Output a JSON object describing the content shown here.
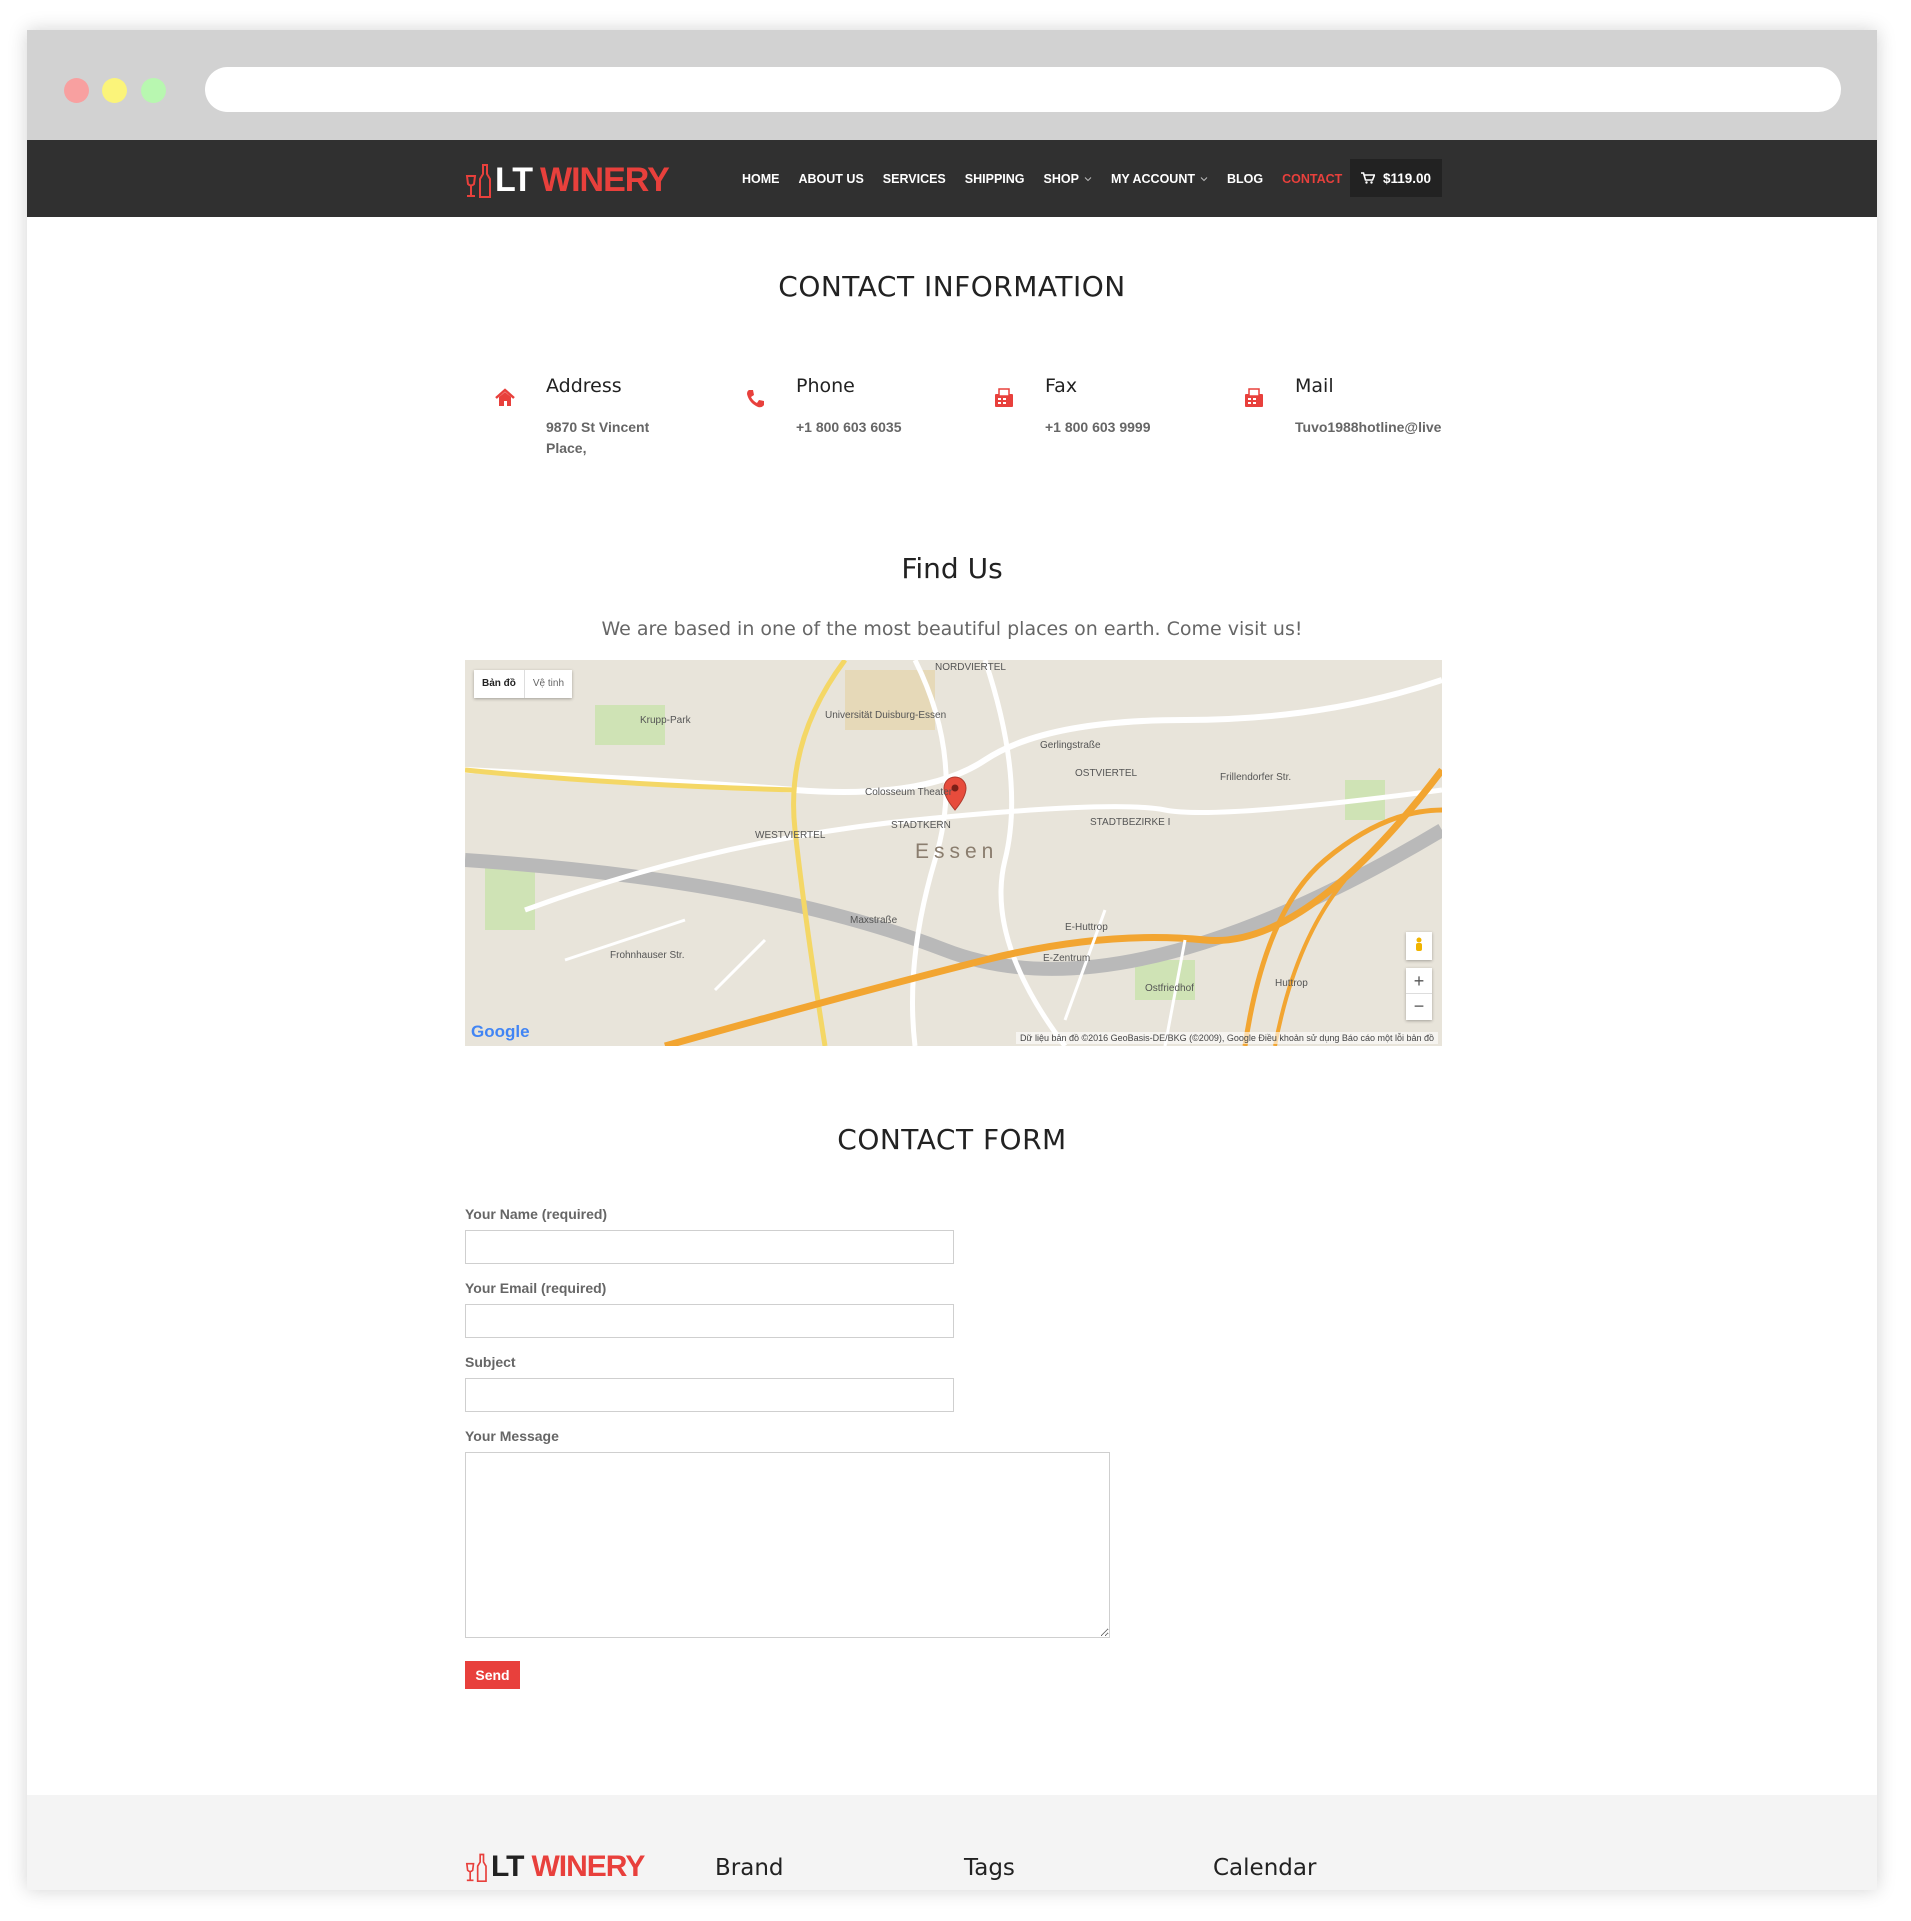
{
  "site": {
    "logo_a": "LT",
    "logo_b": "WINERY",
    "accent": "#e8403c",
    "nav_bg": "#303030"
  },
  "nav": {
    "items": [
      {
        "label": "HOME"
      },
      {
        "label": "ABOUT US"
      },
      {
        "label": "SERVICES"
      },
      {
        "label": "SHIPPING"
      },
      {
        "label": "SHOP"
      },
      {
        "label": "MY ACCOUNT"
      },
      {
        "label": "BLOG"
      },
      {
        "label": "CONTACT"
      }
    ],
    "cart_total": "$119.00"
  },
  "contact_info": {
    "title": "CONTACT INFORMATION",
    "items": [
      {
        "title": "Address",
        "value_line1": "9870 St Vincent",
        "value_line2": "Place,",
        "icon": "home-icon"
      },
      {
        "title": "Phone",
        "value_line1": "+1 800 603 6035",
        "icon": "phone-icon"
      },
      {
        "title": "Fax",
        "value_line1": "+1 800 603 9999",
        "icon": "fax-icon"
      },
      {
        "title": "Mail",
        "value_line1": "Tuvo1988hotline@live",
        "icon": "mail-icon"
      }
    ]
  },
  "find_us": {
    "title": "Find Us",
    "subtitle": "We are based in one of the most beautiful places on earth. Come visit us!"
  },
  "map": {
    "type_map": "Bản đồ",
    "type_satellite": "Vệ tinh",
    "city": "Essen",
    "labels": [
      "NORDVIERTEL",
      "Universität Duisburg-Essen",
      "Krupp-Park",
      "Colosseum Theater",
      "WESTVIERTEL",
      "STADTKERN",
      "OSTVIERTEL",
      "STADTBEZIRKE I",
      "Gerlingstraße",
      "Frillendorfer Str.",
      "Maxstraße",
      "Frohnhauser Str.",
      "Huttrop",
      "Ostfriedhof",
      "E-Zentrum",
      "E-Huttrop"
    ],
    "zoom_in": "+",
    "zoom_out": "−",
    "google": "Google",
    "attribution": "Dữ liệu bản đồ ©2016 GeoBasis-DE/BKG (©2009), Google   Điều khoản sử dụng   Báo cáo một lỗi bản đồ"
  },
  "form": {
    "title": "CONTACT FORM",
    "name_label": "Your Name (required)",
    "email_label": "Your Email (required)",
    "subject_label": "Subject",
    "message_label": "Your Message",
    "send_label": "Send"
  },
  "footer": {
    "brand": "Brand",
    "tags": "Tags",
    "calendar": "Calendar"
  }
}
